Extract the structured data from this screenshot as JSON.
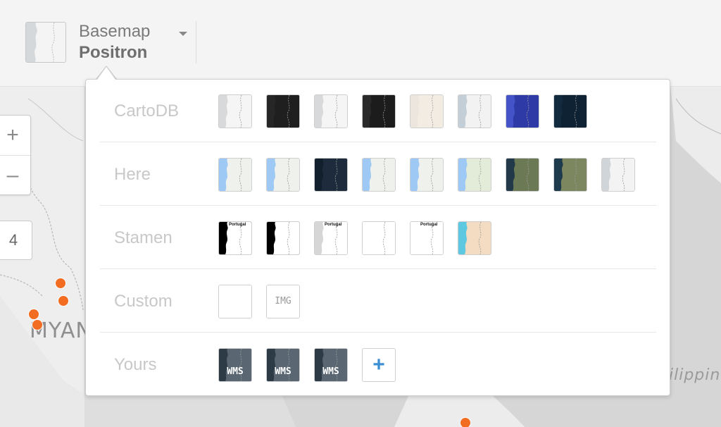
{
  "map": {
    "labels": {
      "myanmar": "MYAN",
      "philippines": "ilippin"
    },
    "point_color": "#f26c21"
  },
  "basemap_selector": {
    "title": "Basemap",
    "value": "Positron",
    "icon": "caret-down-icon"
  },
  "zoom": {
    "in_label": "+",
    "out_label": "–",
    "level": "4"
  },
  "panel": {
    "categories": [
      {
        "label": "CartoDB",
        "tiles": [
          {
            "style": "light",
            "land": "#f5f5f5",
            "sea": "#d7d9db"
          },
          {
            "style": "dark",
            "land": "#1f1f1f",
            "sea": "#262626"
          },
          {
            "style": "light-nolabels",
            "land": "#f5f5f5",
            "sea": "#d7d9db"
          },
          {
            "style": "dark-nolabels",
            "land": "#1c1c1c",
            "sea": "#2a2a2a"
          },
          {
            "style": "antique",
            "land": "#f3ece3",
            "sea": "#ece6df"
          },
          {
            "style": "flat",
            "land": "#f2f2f2",
            "sea": "#c4ced7"
          },
          {
            "style": "eco",
            "land": "#2e3aa6",
            "sea": "#4454c8"
          },
          {
            "style": "midnight",
            "land": "#0e2233",
            "sea": "#112a3d"
          }
        ]
      },
      {
        "label": "Here",
        "tiles": [
          {
            "style": "normal-day",
            "land": "#eef1ec",
            "sea": "#9fc9f5"
          },
          {
            "style": "normal-grey",
            "land": "#eef1ec",
            "sea": "#9fc9f5"
          },
          {
            "style": "night",
            "land": "#1d2b3c",
            "sea": "#12202e"
          },
          {
            "style": "reduced",
            "land": "#eef1ec",
            "sea": "#9fc9f5"
          },
          {
            "style": "transit",
            "land": "#eef1ec",
            "sea": "#9fc9f5"
          },
          {
            "style": "terrain",
            "land": "#e3ecd9",
            "sea": "#9fc9f5"
          },
          {
            "style": "satellite",
            "land": "#6b7a55",
            "sea": "#22394a"
          },
          {
            "style": "hybrid",
            "land": "#7c8760",
            "sea": "#1e3a4d"
          },
          {
            "style": "grey",
            "land": "#f3f3f3",
            "sea": "#d0d5da"
          }
        ]
      },
      {
        "label": "Stamen",
        "tiles": [
          {
            "style": "toner",
            "land": "#ffffff",
            "sea": "#000000",
            "label": "Portugal"
          },
          {
            "style": "toner-bg",
            "land": "#ffffff",
            "sea": "#000000",
            "label": ""
          },
          {
            "style": "toner-lite",
            "land": "#ffffff",
            "sea": "#d6d6d6",
            "label": "Portugal"
          },
          {
            "style": "toner-lines",
            "land": "#ffffff",
            "sea": "#ffffff",
            "label": ""
          },
          {
            "style": "toner-labels",
            "land": "#ffffff",
            "sea": "#ffffff",
            "label": "Portugal"
          },
          {
            "style": "watercolor",
            "land": "#f3dcc1",
            "sea": "#5ec8e0",
            "label": ""
          }
        ]
      },
      {
        "label": "Custom",
        "tiles": [
          {
            "style": "xyz",
            "text": ""
          },
          {
            "style": "image",
            "text": "IMG"
          }
        ]
      },
      {
        "label": "Yours",
        "tiles": [
          {
            "style": "wms",
            "text": "WMS"
          },
          {
            "style": "wms",
            "text": "WMS"
          },
          {
            "style": "wms",
            "text": "WMS"
          },
          {
            "style": "add",
            "text": "+"
          }
        ]
      }
    ]
  }
}
